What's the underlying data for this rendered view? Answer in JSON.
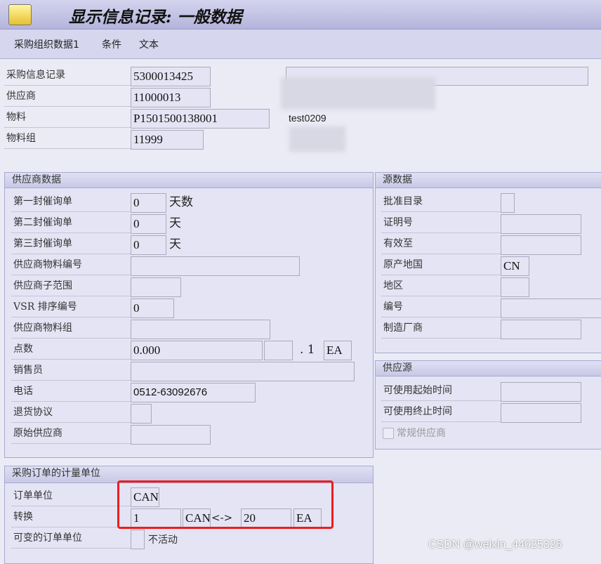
{
  "window": {
    "title": "显示信息记录: 一般数据"
  },
  "tabs": [
    "采购组织数据1",
    "条件",
    "文本"
  ],
  "header": {
    "info_record": {
      "label": "采购信息记录",
      "value": "5300013425"
    },
    "vendor": {
      "label": "供应商",
      "value": "11000013"
    },
    "material": {
      "label": "物料",
      "value": "P1501500138001",
      "description": "test0209"
    },
    "material_group": {
      "label": "物料组",
      "value": "11999"
    }
  },
  "vendor_data": {
    "title": "供应商数据",
    "reminder1": {
      "label": "第一封催询单",
      "value": "0",
      "unit": "天数"
    },
    "reminder2": {
      "label": "第二封催询单",
      "value": "0",
      "unit": "天"
    },
    "reminder3": {
      "label": "第三封催询单",
      "value": "0",
      "unit": "天"
    },
    "vendor_material_no": {
      "label": "供应商物料编号",
      "value": ""
    },
    "vendor_subrange": {
      "label": "供应商子范围",
      "value": ""
    },
    "vsr_sort_no": {
      "label": "VSR 排序编号",
      "value": "0"
    },
    "vendor_material_group": {
      "label": "供应商物料组",
      "value": ""
    },
    "points": {
      "label": "点数",
      "value": "0.000",
      "per": "",
      "dot_one": ". 1",
      "unit": "EA"
    },
    "salesperson": {
      "label": "销售员",
      "value": ""
    },
    "telephone": {
      "label": "电话",
      "value": "0512-63092676"
    },
    "return_agreement": {
      "label": "退货协议",
      "value": ""
    },
    "prior_vendor": {
      "label": "原始供应商",
      "value": ""
    }
  },
  "origin_data": {
    "title": "源数据",
    "catalog": {
      "label": "批准目录"
    },
    "certificate_no": {
      "label": "证明号",
      "value": ""
    },
    "valid_to": {
      "label": "有效至",
      "value": ""
    },
    "country_of_origin": {
      "label": "原产地国",
      "value": "CN"
    },
    "region": {
      "label": "地区",
      "value": ""
    },
    "number": {
      "label": "编号",
      "value": ""
    },
    "manufacturer": {
      "label": "制造厂商",
      "value": ""
    }
  },
  "supply_source": {
    "title": "供应源",
    "available_from": {
      "label": "可使用起始时间",
      "value": ""
    },
    "available_to": {
      "label": "可使用终止时间",
      "value": ""
    },
    "regular_vendor": {
      "label": "常规供应商",
      "checked": false
    }
  },
  "po_unit": {
    "title": "采购订单的计量单位",
    "order_unit": {
      "label": "订单单位",
      "value": "CAN"
    },
    "conversion": {
      "label": "转换",
      "qty1": "1",
      "unit1": "CAN",
      "arrow": "<->",
      "qty2": "20",
      "unit2": "EA"
    },
    "variable_unit": {
      "label": "可变的订单单位",
      "status": "不活动"
    }
  },
  "watermark": "CSDN @weixin_44025326",
  "colors": {
    "highlight_box": "#ee1c1c",
    "background": "#ebebf6",
    "field": "#e4e4f4"
  }
}
